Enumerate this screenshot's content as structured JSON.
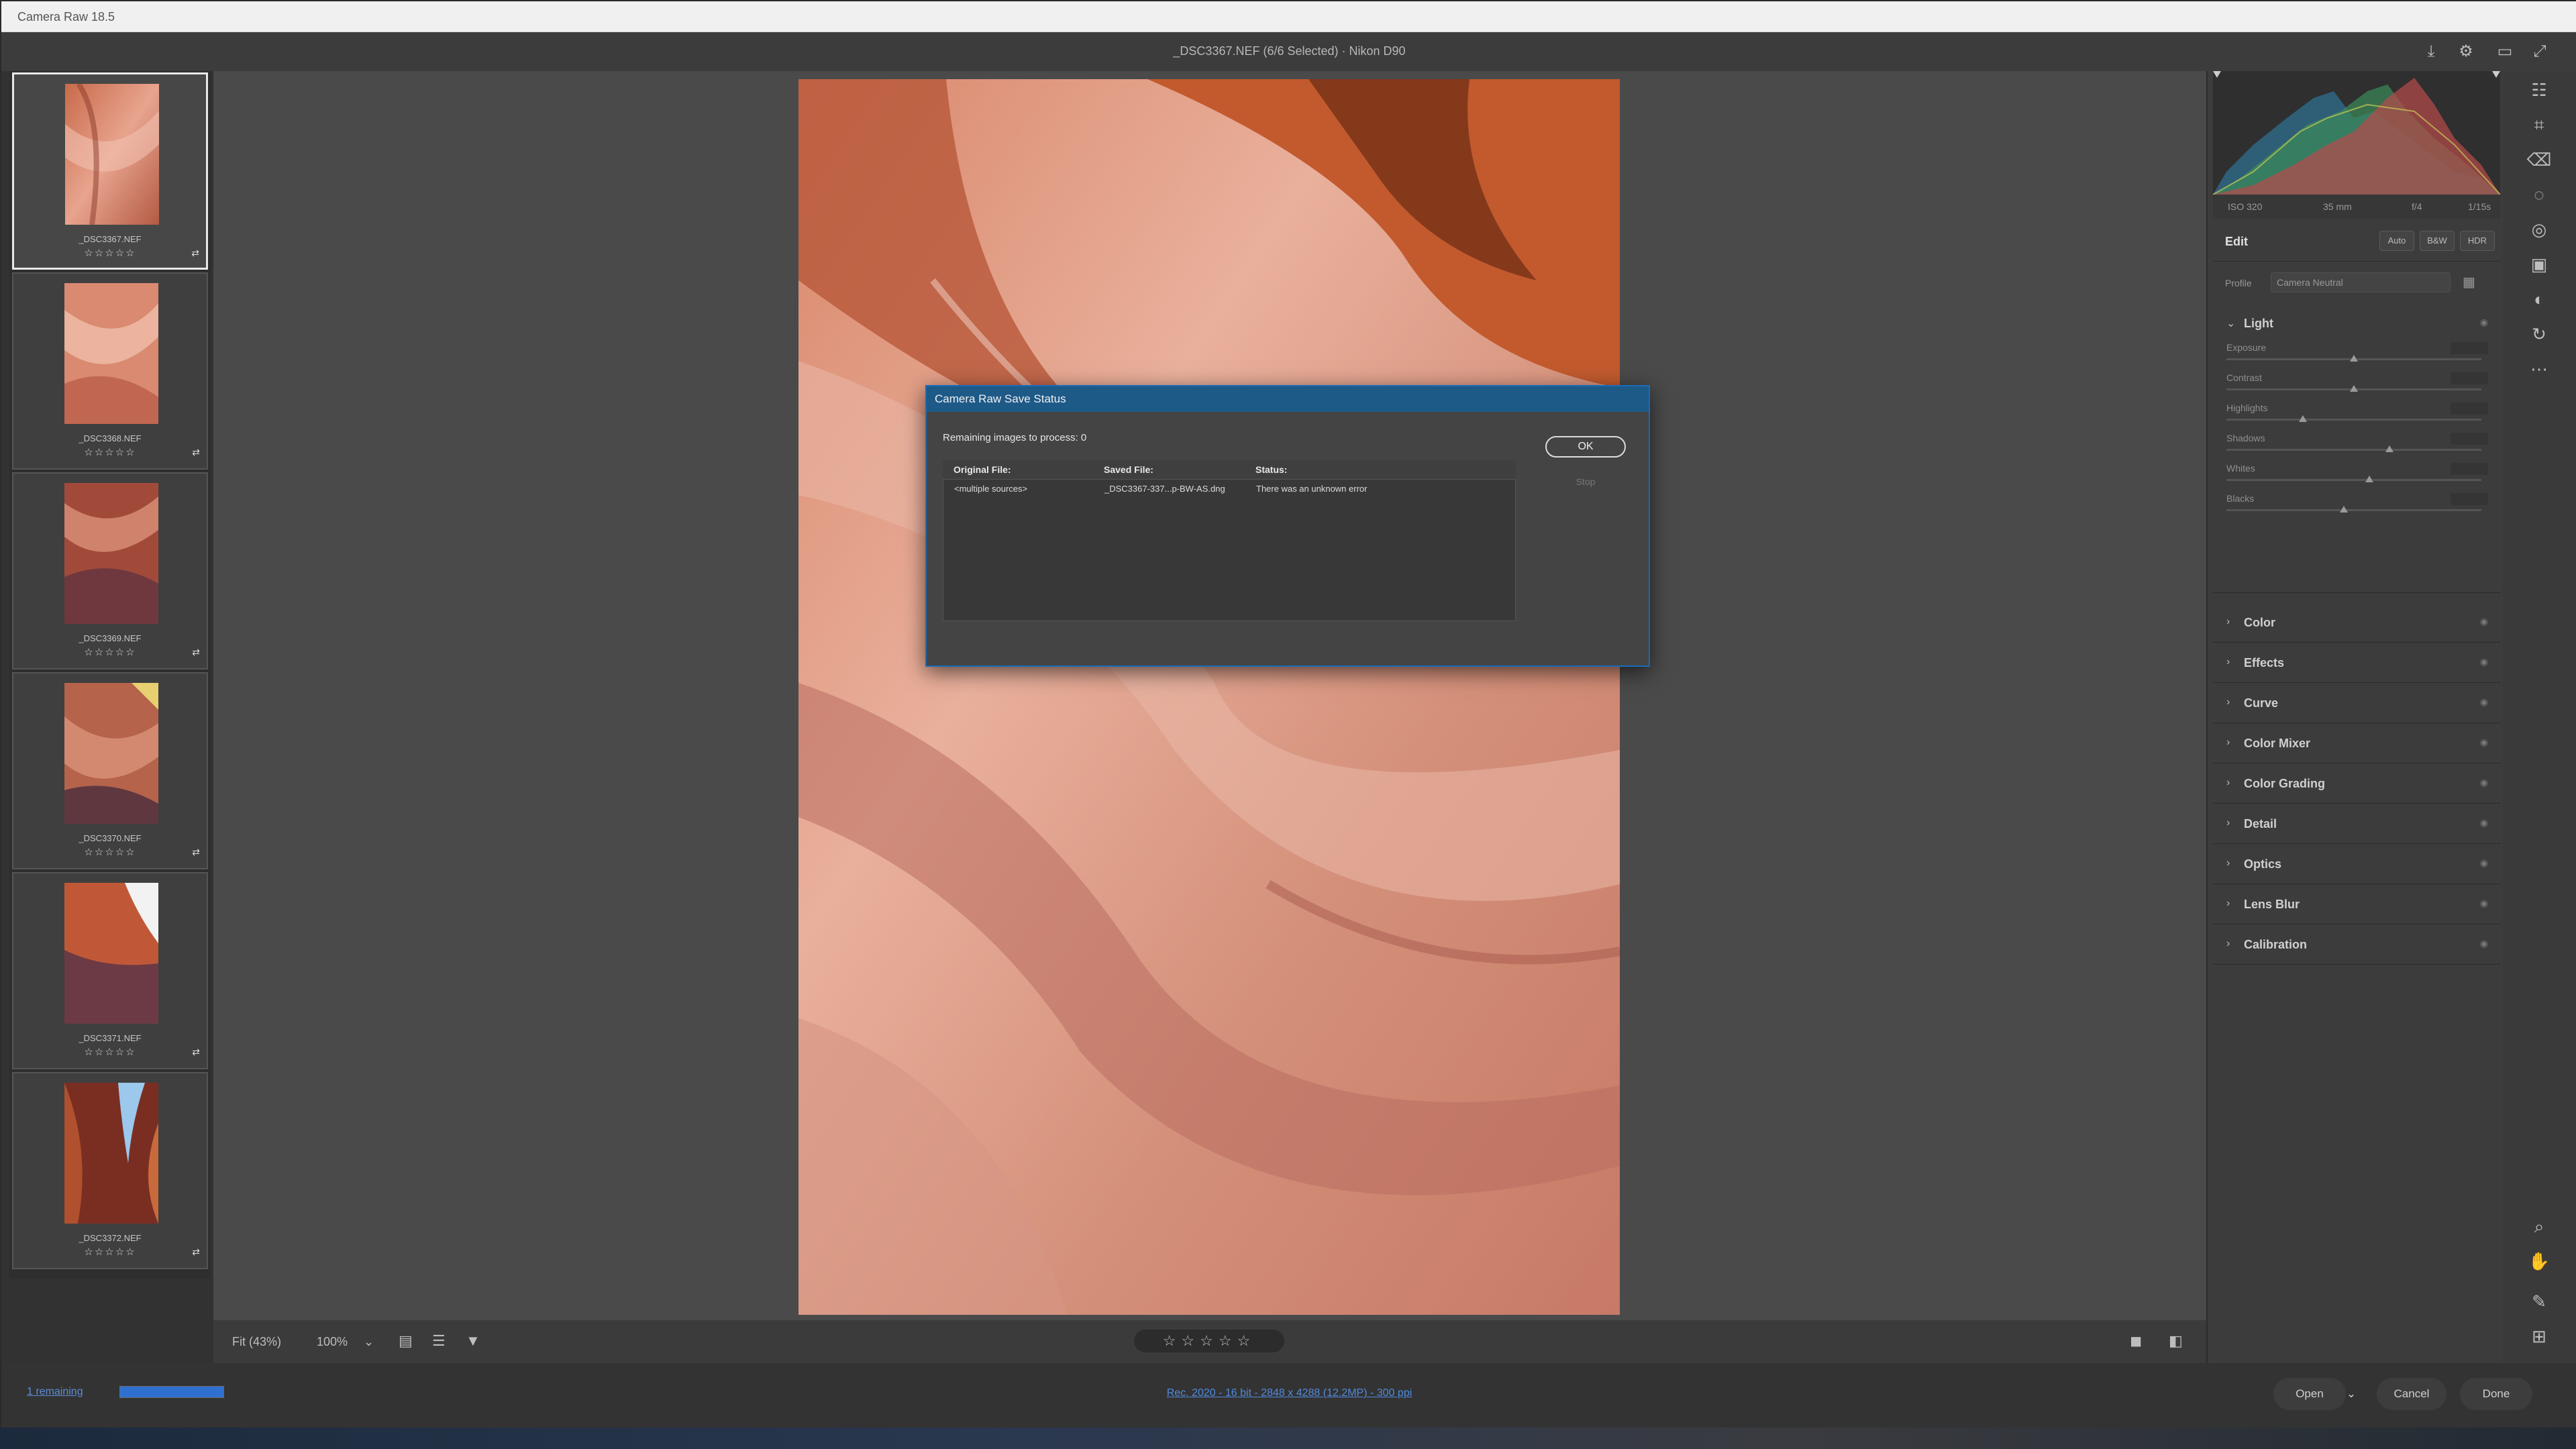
{
  "window": {
    "title": "Camera Raw 18.5"
  },
  "header": {
    "file_title": "_DSC3367.NEF (6/6 Selected)  ·  Nikon D90"
  },
  "filmstrip": [
    {
      "name": "_DSC3367.NEF",
      "stars": "☆☆☆☆☆",
      "badge": "⇄"
    },
    {
      "name": "_DSC3368.NEF",
      "stars": "☆☆☆☆☆",
      "badge": "⇄"
    },
    {
      "name": "_DSC3369.NEF",
      "stars": "☆☆☆☆☆",
      "badge": "⇄"
    },
    {
      "name": "_DSC3370.NEF",
      "stars": "☆☆☆☆☆",
      "badge": "⇄"
    },
    {
      "name": "_DSC3371.NEF",
      "stars": "☆☆☆☆☆",
      "badge": "⇄"
    },
    {
      "name": "_DSC3372.NEF",
      "stars": "☆☆☆☆☆",
      "badge": "⇄"
    }
  ],
  "viewbar": {
    "fit": "Fit (43%)",
    "zoom": "100%",
    "rating": "☆☆☆☆☆"
  },
  "histogram_meta": {
    "iso": "ISO 320",
    "focal": "35 mm",
    "aperture": "f/4",
    "shutter": "1/15s"
  },
  "edit": {
    "label": "Edit",
    "auto": "Auto",
    "bw": "B&W",
    "hdr": "HDR",
    "profile_label": "Profile",
    "profile_value": "Camera Neutral"
  },
  "light": {
    "label": "Light",
    "sliders": [
      {
        "name": "Exposure",
        "level": 0.5
      },
      {
        "name": "Contrast",
        "level": 0.5
      },
      {
        "name": "Highlights",
        "level": 0.3
      },
      {
        "name": "Shadows",
        "level": 0.64
      },
      {
        "name": "Whites",
        "level": 0.56
      },
      {
        "name": "Blacks",
        "level": 0.46
      }
    ]
  },
  "sections": [
    "Color",
    "Effects",
    "Curve",
    "Color Mixer",
    "Color Grading",
    "Detail",
    "Optics",
    "Lens Blur",
    "Calibration"
  ],
  "bottom": {
    "remaining": "1 remaining",
    "progress": 1.0,
    "workflow": "Rec. 2020 - 16 bit - 2848 x 4288 (12.2MP) - 300 ppi",
    "open": "Open",
    "cancel": "Cancel",
    "done": "Done"
  },
  "dialog": {
    "title": "Camera Raw Save Status",
    "remaining": "Remaining images to process: 0",
    "col_original": "Original File:",
    "col_saved": "Saved File:",
    "col_status": "Status:",
    "row_original": "<multiple sources>",
    "row_saved": "_DSC3367-337...p-BW-AS.dng",
    "row_status": "There was an unknown error",
    "ok": "OK",
    "stop": "Stop"
  },
  "colors": {
    "accent": "#1e5a88",
    "progress": "#2f6fd0",
    "link": "#4f8be0"
  },
  "icons": [
    "save-icon",
    "gear-icon",
    "frame-icon",
    "fullscreen-icon",
    "edit-sliders-icon",
    "crop-icon",
    "eraser-icon",
    "mask-icon",
    "redeye-icon",
    "presets-icon",
    "snapshot-icon",
    "more-icon",
    "zoom-icon",
    "hand-icon",
    "eyedropper-icon",
    "grid-icon"
  ]
}
